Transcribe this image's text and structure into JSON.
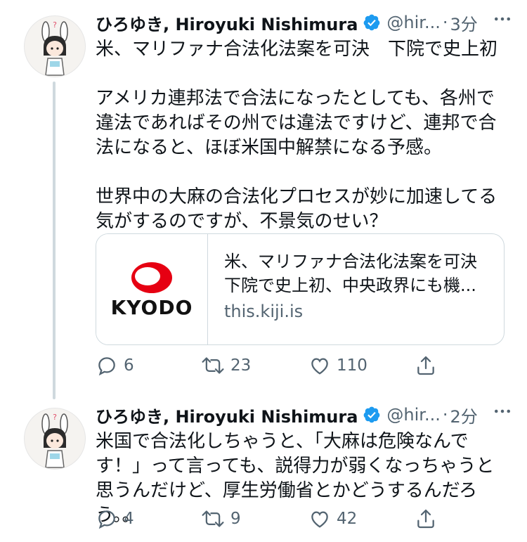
{
  "tweets": [
    {
      "name": "ひろゆき, Hiroyuki Nishimura",
      "handle": "@hir...",
      "dot": "·",
      "time": "3分",
      "text": "米、マリファナ合法化法案を可決　下院で史上初\n\nアメリカ連邦法で合法になったとしても、各州で違法であればその州では違法ですけど、連邦で合法になると、ほぼ米国中解禁になる予感。\n\n世界中の大麻の合法化プロセスが妙に加速してる気がするのですが、不景気のせい？",
      "card": {
        "brand": "KYODO",
        "title_line1": "米、マリファナ合法化法案を可決",
        "title_line2": "下院で史上初、中央政界にも機...",
        "domain": "this.kiji.is"
      },
      "replies": "6",
      "retweets": "23",
      "likes": "110"
    },
    {
      "name": "ひろゆき, Hiroyuki Nishimura",
      "handle": "@hir...",
      "dot": "·",
      "time": "2分",
      "text": "米国で合法化しちゃうと、「大麻は危険なんです！」って言っても、説得力が弱くなっちゃうと思うんだけど、厚生労働省とかどうするんだろう。。",
      "replies": "4",
      "retweets": "9",
      "likes": "42"
    }
  ],
  "icons": {
    "more": "more-horizontal-icon",
    "verified": "verified-badge-icon",
    "reply": "reply-icon",
    "retweet": "retweet-icon",
    "like": "like-icon",
    "share": "share-icon"
  },
  "colors": {
    "verified": "#1d9bf0",
    "kyodo_red": "#e60012",
    "muted": "#536471"
  }
}
